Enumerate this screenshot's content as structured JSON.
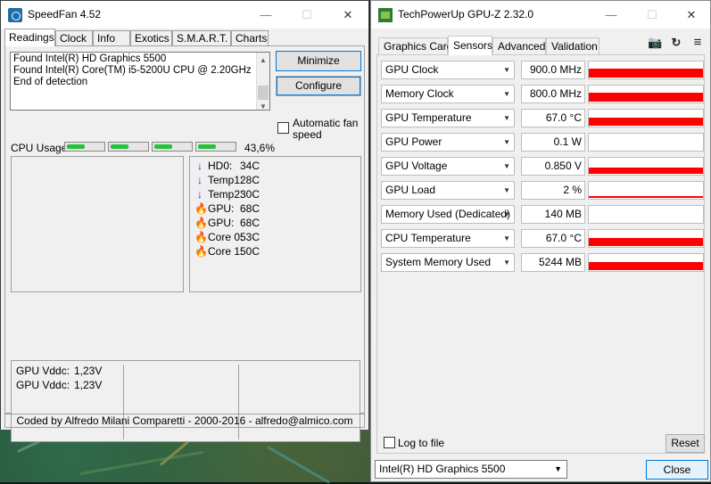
{
  "speedfan": {
    "title": "SpeedFan 4.52",
    "tabs": [
      "Readings",
      "Clock",
      "Info",
      "Exotics",
      "S.M.A.R.T.",
      "Charts"
    ],
    "active_tab": "Readings",
    "log_lines": [
      "Found Intel(R) HD Graphics 5500",
      "Found Intel(R) Core(TM) i5-5200U CPU @ 2.20GHz",
      "End of detection"
    ],
    "buttons": {
      "minimize": "Minimize",
      "configure": "Configure"
    },
    "auto_fan_label": "Automatic fan speed",
    "auto_fan_checked": false,
    "cpu_usage_label": "CPU Usage",
    "cpu_usage_value": "43,6%",
    "cpu_meters": 4,
    "temperatures": [
      {
        "name": "HD0:",
        "value": "34C",
        "icon": "arrow-down-icon"
      },
      {
        "name": "Temp1:",
        "value": "28C",
        "icon": "arrow-down-icon"
      },
      {
        "name": "Temp2:",
        "value": "30C",
        "icon": "arrow-down-icon"
      },
      {
        "name": "GPU:",
        "value": "68C",
        "icon": "flame-icon"
      },
      {
        "name": "GPU:",
        "value": "68C",
        "icon": "flame-icon"
      },
      {
        "name": "Core 0:",
        "value": "53C",
        "icon": "flame-icon"
      },
      {
        "name": "Core 1:",
        "value": "50C",
        "icon": "flame-icon"
      }
    ],
    "voltages": [
      {
        "name": "GPU Vddc:",
        "value": "1,23V"
      },
      {
        "name": "GPU Vddc:",
        "value": "1,23V"
      }
    ],
    "footer": "Coded by Alfredo Milani Comparetti - 2000-2016 - alfredo@almico.com"
  },
  "gpuz": {
    "title": "TechPowerUp GPU-Z 2.32.0",
    "tabs": [
      "Graphics Card",
      "Sensors",
      "Advanced",
      "Validation"
    ],
    "active_tab": "Sensors",
    "sensors": [
      {
        "label": "GPU Clock",
        "value": "900.0 MHz",
        "graph_level": 0.55
      },
      {
        "label": "Memory Clock",
        "value": "800.0 MHz",
        "graph_level": 0.55
      },
      {
        "label": "GPU Temperature",
        "value": "67.0 °C",
        "graph_level": 0.45
      },
      {
        "label": "GPU Power",
        "value": "0.1 W",
        "graph_level": 0
      },
      {
        "label": "GPU Voltage",
        "value": "0.850 V",
        "graph_level": 0.35
      },
      {
        "label": "GPU Load",
        "value": "2 %",
        "graph_level": 0.1
      },
      {
        "label": "Memory Used (Dedicated)",
        "value": "140 MB",
        "graph_level": 0
      },
      {
        "label": "CPU Temperature",
        "value": "67.0 °C",
        "graph_level": 0.45
      },
      {
        "label": "System Memory Used",
        "value": "5244 MB",
        "graph_level": 0.5
      }
    ],
    "log_to_file_label": "Log to file",
    "log_to_file_checked": false,
    "reset_label": "Reset",
    "device_select": "Intel(R) HD Graphics 5500",
    "close_label": "Close",
    "graph_color": "#ff0000"
  }
}
